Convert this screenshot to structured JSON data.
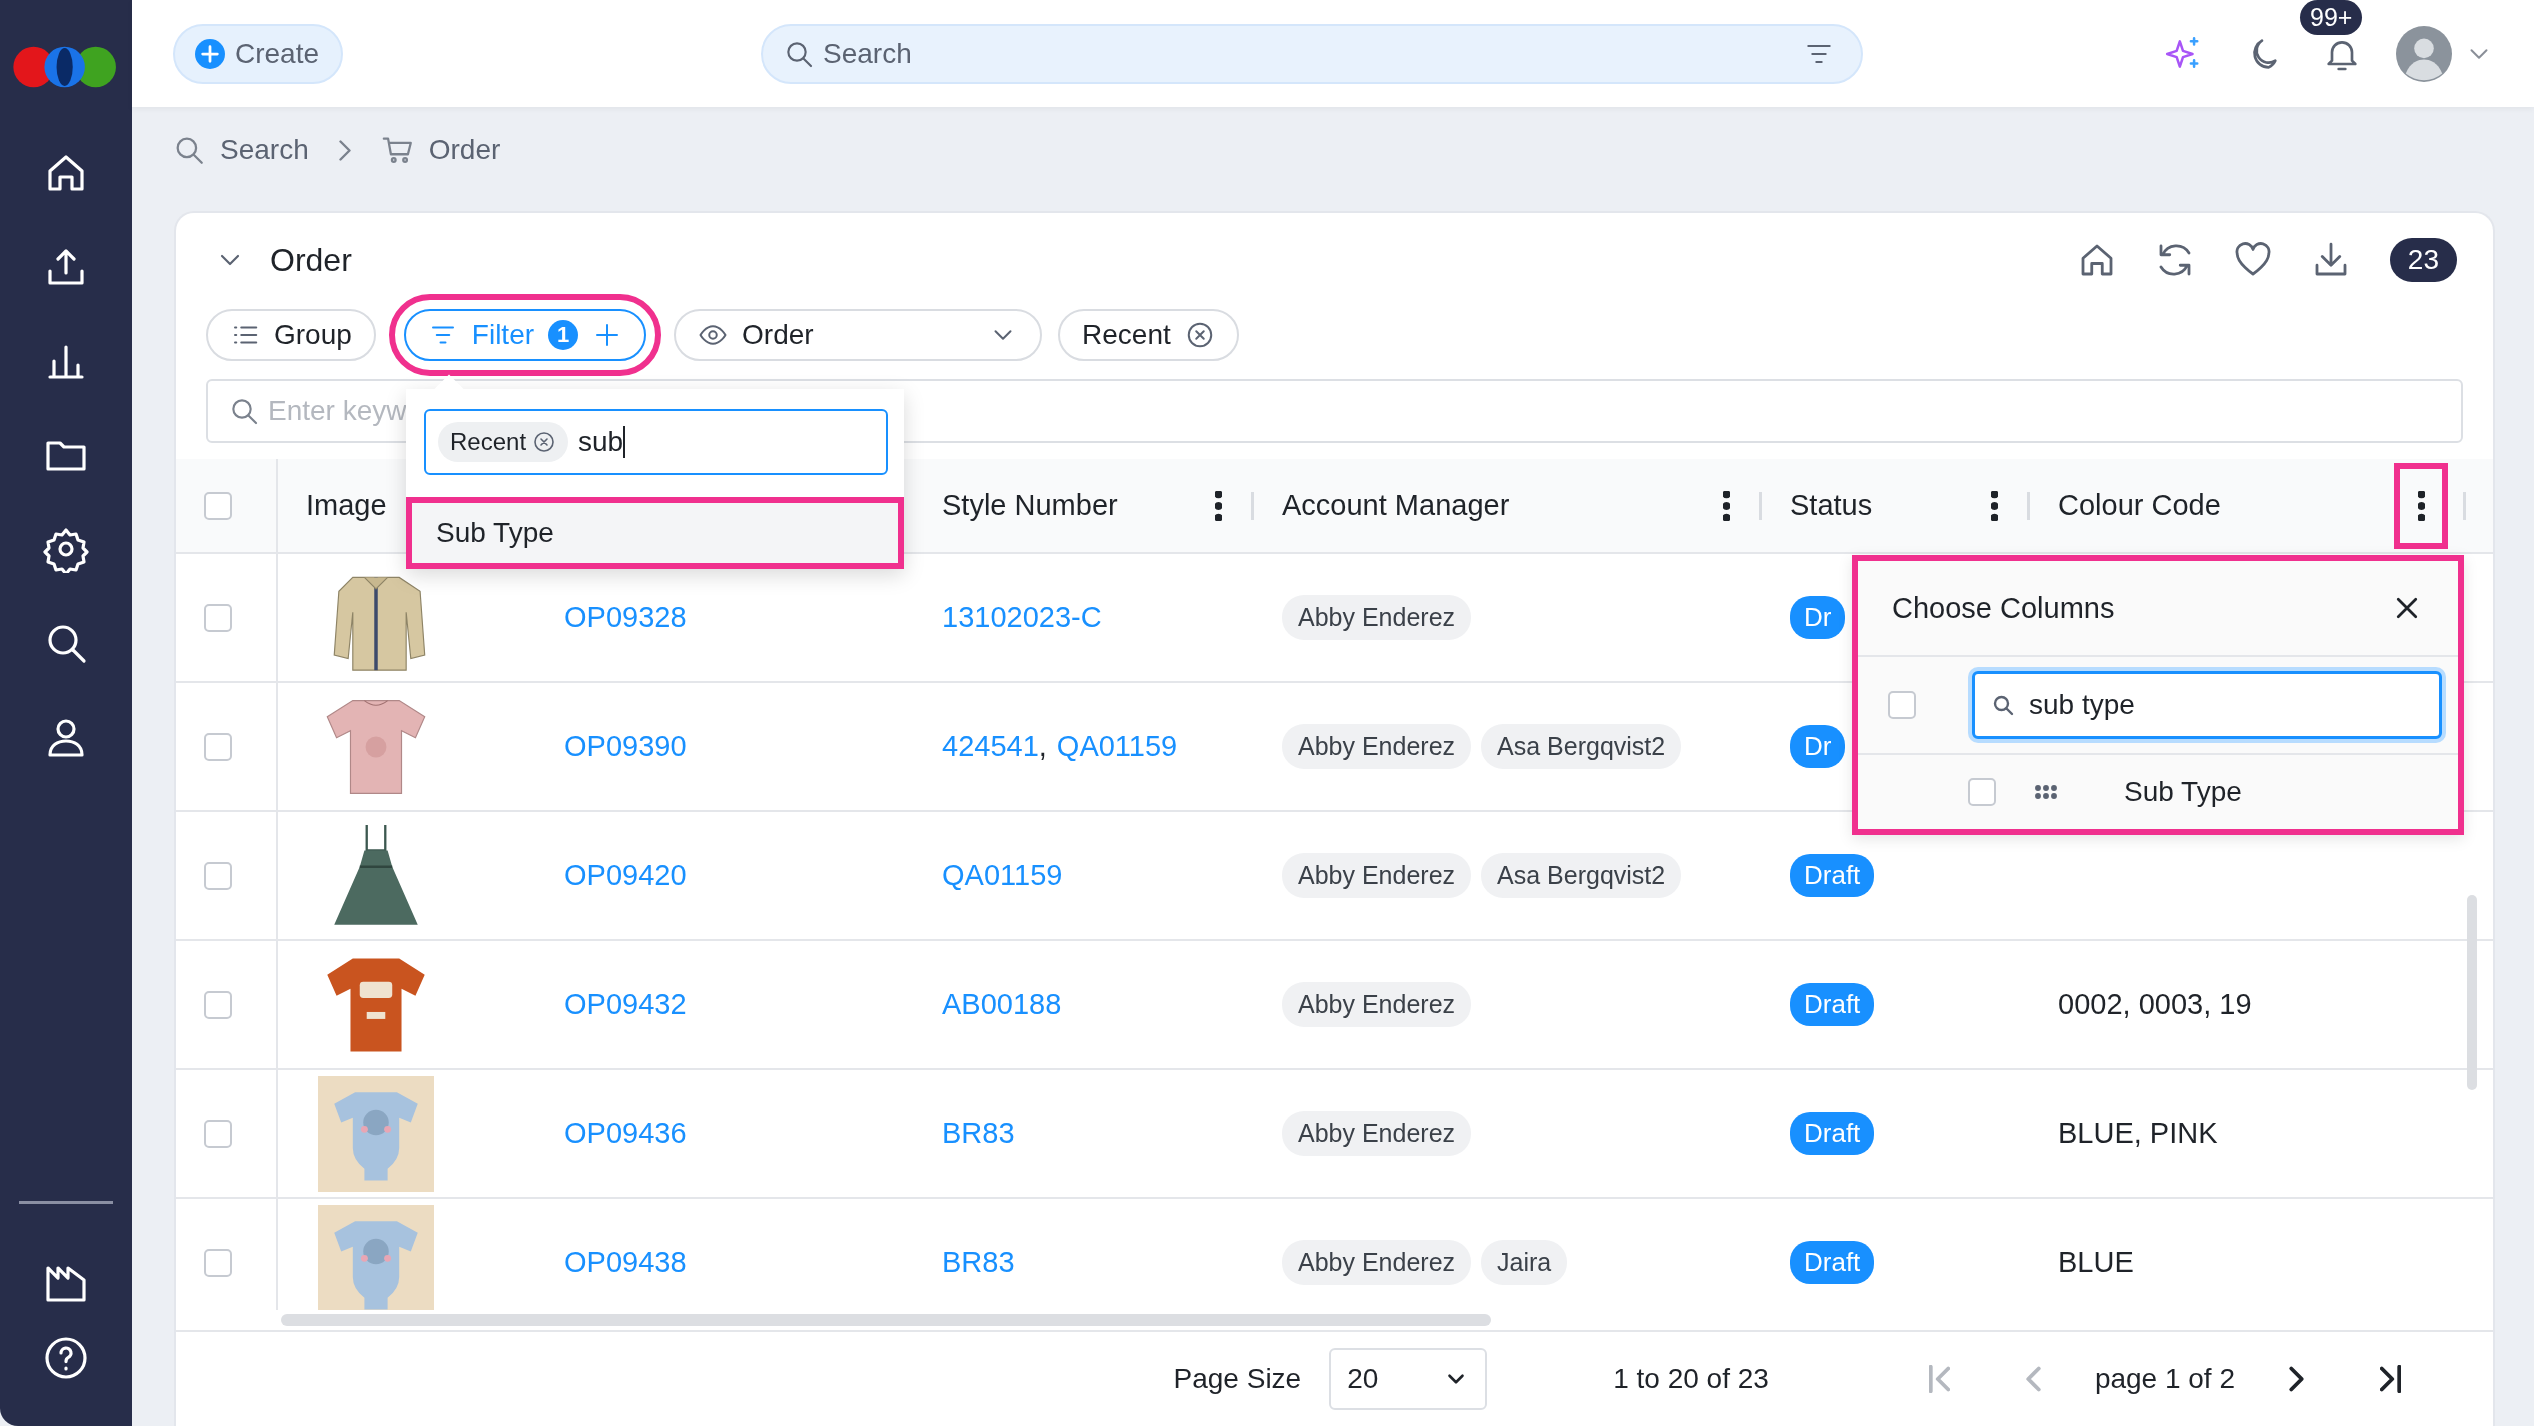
{
  "sidebar": {
    "items": [
      {
        "kind": "home"
      },
      {
        "kind": "upload"
      },
      {
        "kind": "chart"
      },
      {
        "kind": "folder"
      },
      {
        "kind": "settings"
      },
      {
        "kind": "search"
      },
      {
        "kind": "user"
      }
    ],
    "bottom_items": [
      {
        "kind": "factory"
      },
      {
        "kind": "help"
      }
    ]
  },
  "topbar": {
    "create": "Create",
    "search_placeholder": "Search",
    "notifications": "99+"
  },
  "breadcrumb": [
    {
      "kind": "search",
      "label": "Search"
    },
    {
      "kind": "cart",
      "label": "Order"
    }
  ],
  "panel": {
    "title": "Order",
    "expanded": true,
    "count": "23",
    "toolbar": {
      "group": "Group",
      "filter": {
        "label": "Filter",
        "count": "1",
        "highlighted": true
      },
      "view": "Order",
      "chip": "Recent"
    },
    "keyword_placeholder": "Enter keyw",
    "filter_dropdown": {
      "tag": "Recent",
      "value": "sub",
      "options": [
        {
          "label": "Sub Type",
          "highlighted": true
        }
      ]
    },
    "table": {
      "separator": ",",
      "columns": [
        {
          "kind": "checkbox",
          "checked": false
        },
        {
          "kind": "text",
          "label": "Image"
        },
        {
          "kind": "blank"
        },
        {
          "kind": "menu",
          "label": "Style Number",
          "highlighted": false
        },
        {
          "kind": "menu",
          "label": "Account Manager",
          "highlighted": false
        },
        {
          "kind": "menu",
          "label": "Status",
          "highlighted": false
        },
        {
          "kind": "menu",
          "label": "Colour Code",
          "highlighted": true
        }
      ],
      "rows": [
        {
          "checked": false,
          "order": "OP09328",
          "styles": [
            "13102023-C"
          ],
          "managers": [
            "Abby Enderez"
          ],
          "status": "Dr"
        },
        {
          "checked": false,
          "order": "OP09390",
          "styles": [
            "424541",
            "QA01159"
          ],
          "managers": [
            "Abby Enderez",
            "Asa Bergqvist2"
          ],
          "status": "Dr"
        },
        {
          "checked": false,
          "order": "OP09420",
          "styles": [
            "QA01159"
          ],
          "managers": [
            "Abby Enderez",
            "Asa Bergqvist2"
          ],
          "status": "Draft"
        },
        {
          "checked": false,
          "order": "OP09432",
          "styles": [
            "AB00188"
          ],
          "managers": [
            "Abby Enderez"
          ],
          "status": "Draft",
          "colour": "0002, 0003, 19"
        },
        {
          "checked": false,
          "order": "OP09436",
          "styles": [
            "BR83"
          ],
          "managers": [
            "Abby Enderez"
          ],
          "status": "Draft",
          "colour": "BLUE, PINK"
        },
        {
          "checked": false,
          "order": "OP09438",
          "styles": [
            "BR83"
          ],
          "managers": [
            "Abby Enderez",
            "Jaira"
          ],
          "status": "Draft",
          "colour": "BLUE"
        }
      ]
    },
    "choose_columns": {
      "title": "Choose Columns",
      "highlighted": true,
      "select_all_checked": false,
      "search_value": "sub type",
      "items": [
        {
          "label": "Sub Type",
          "checked": false
        }
      ]
    },
    "pagination": {
      "page_size_label": "Page Size",
      "page_size": "20",
      "range": "1 to 20 of 23",
      "page": "page 1 of 2",
      "first_disabled": true,
      "prev_disabled": true,
      "next_disabled": false,
      "last_disabled": false
    }
  }
}
